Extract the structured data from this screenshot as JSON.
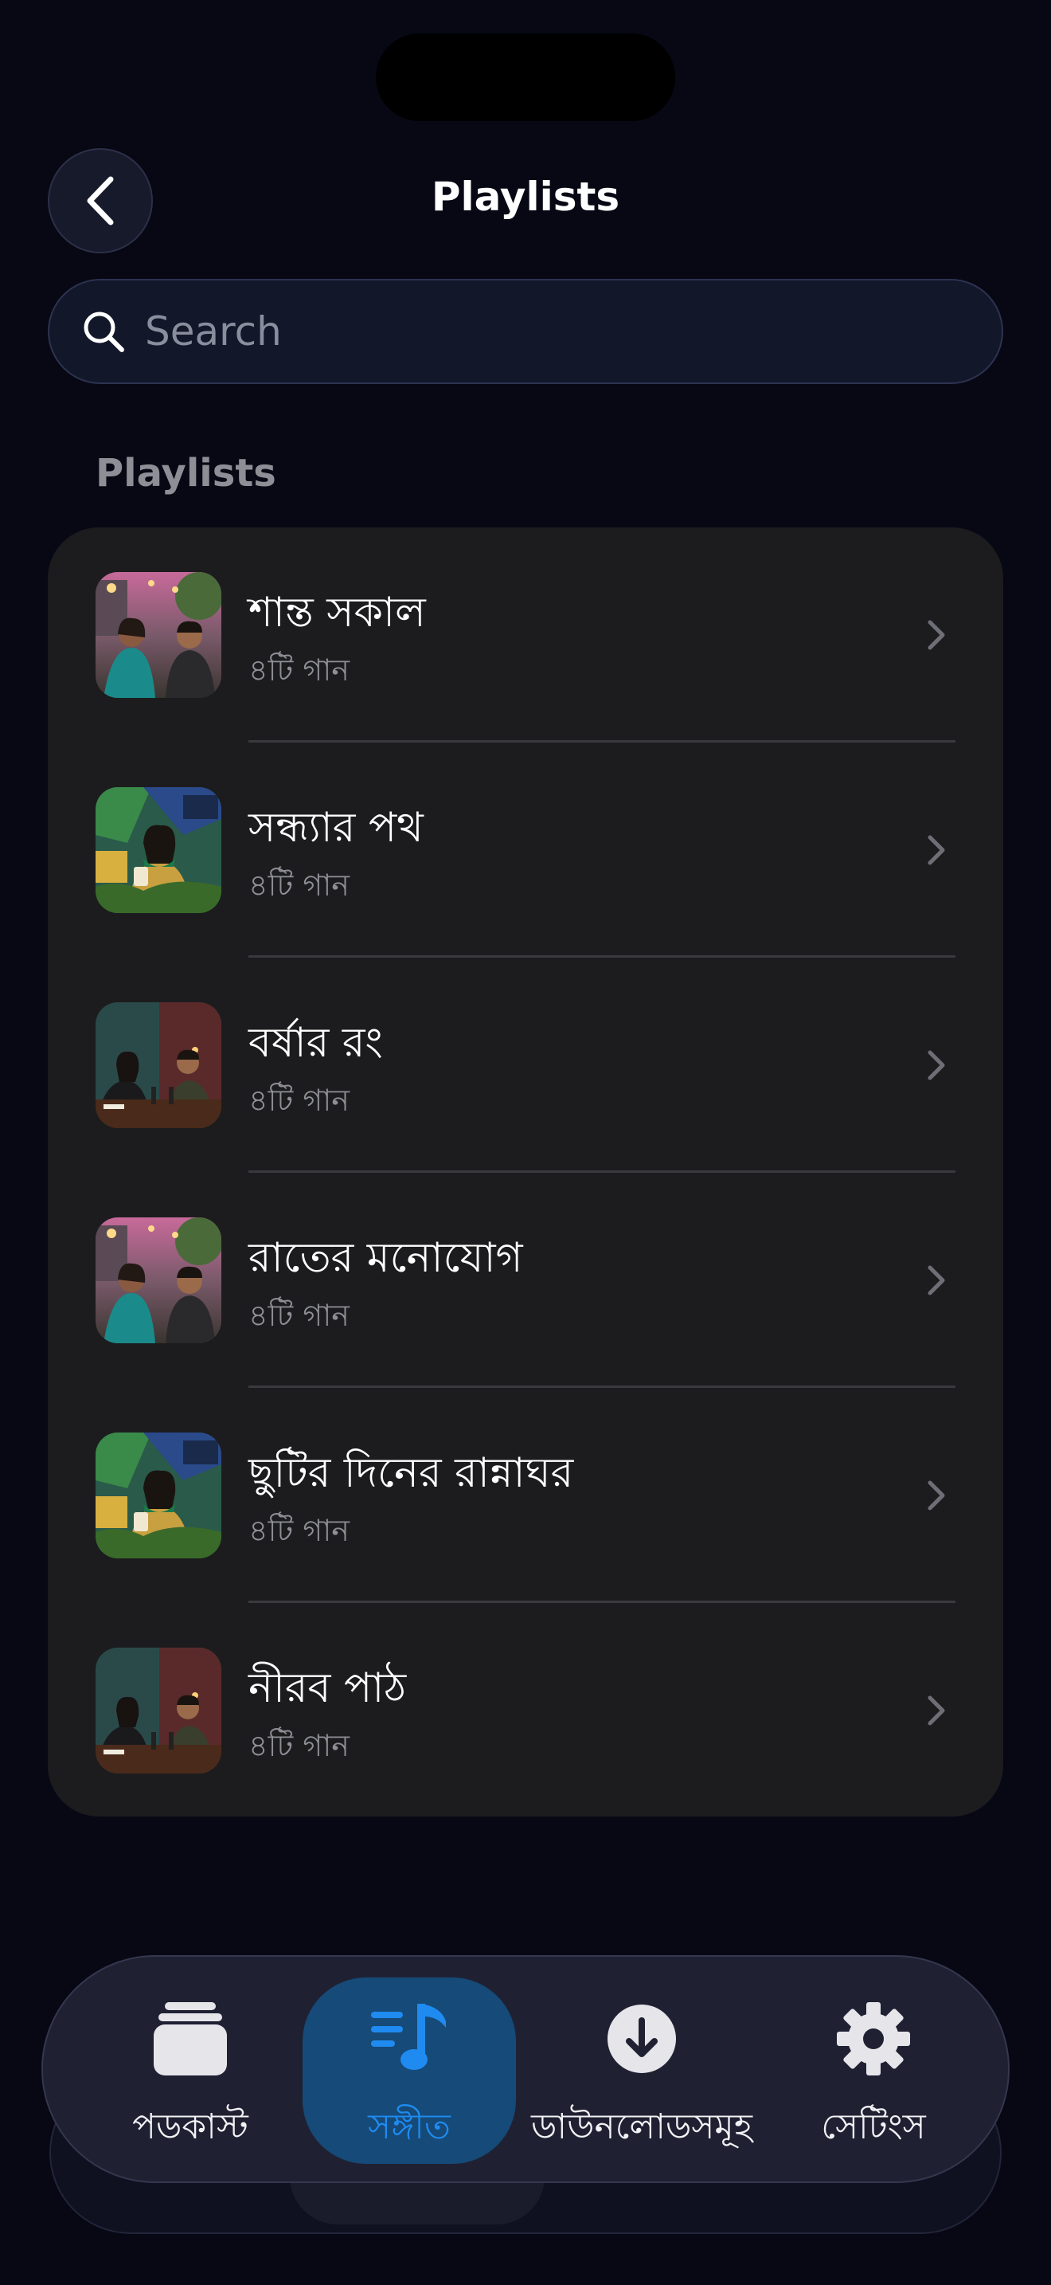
{
  "header": {
    "title": "Playlists"
  },
  "search": {
    "placeholder": "Search"
  },
  "section": {
    "label": "Playlists"
  },
  "playlists": [
    {
      "title": "শান্ত সকাল",
      "subtitle": "৪টি গান",
      "art": "street"
    },
    {
      "title": "সন্ধ্যার পথ",
      "subtitle": "৪টি গান",
      "art": "garden"
    },
    {
      "title": "বর্ষার রং",
      "subtitle": "৪টি গান",
      "art": "studio"
    },
    {
      "title": "রাতের মনোযোগ",
      "subtitle": "৪টি গান",
      "art": "street"
    },
    {
      "title": "ছুটির দিনের রান্নাঘর",
      "subtitle": "৪টি গান",
      "art": "garden"
    },
    {
      "title": "নীরব পাঠ",
      "subtitle": "৪টি গান",
      "art": "studio"
    }
  ],
  "tabs": [
    {
      "label": "পডকাস্ট",
      "icon": "stack-icon",
      "active": false
    },
    {
      "label": "সঙ্গীত",
      "icon": "music-note-icon",
      "active": true
    },
    {
      "label": "ডাউনলোডসমূহ",
      "icon": "download-icon",
      "active": false
    },
    {
      "label": "সেটিংস",
      "icon": "gear-icon",
      "active": false
    }
  ],
  "colors": {
    "accent": "#1f8bf0",
    "background": "#070814",
    "card": "#1c1c1e"
  }
}
